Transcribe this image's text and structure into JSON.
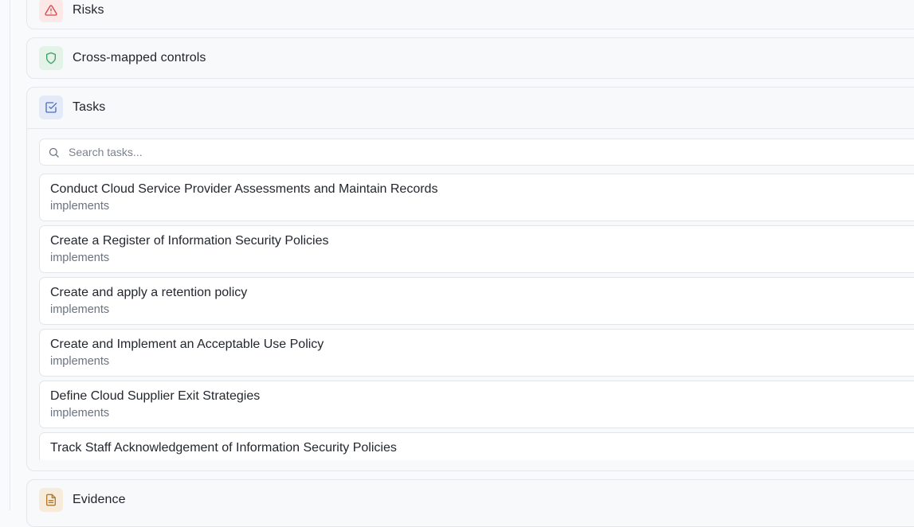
{
  "sections": {
    "risks": {
      "title": "Risks",
      "icon": "alert-triangle-icon",
      "color": "#d64545"
    },
    "cross_mapped": {
      "title": "Cross-mapped controls",
      "icon": "shield-icon",
      "color": "#3f9d63"
    },
    "tasks": {
      "title": "Tasks",
      "icon": "checkbox-icon",
      "color": "#4a6fb5",
      "search_placeholder": "Search tasks...",
      "items": [
        {
          "title": "Conduct Cloud Service Provider Assessments and Maintain Records",
          "relation": "implements"
        },
        {
          "title": "Create a Register of Information Security Policies",
          "relation": "implements"
        },
        {
          "title": "Create and apply a retention policy",
          "relation": "implements"
        },
        {
          "title": "Create and Implement an Acceptable Use Policy",
          "relation": "implements"
        },
        {
          "title": "Define Cloud Supplier Exit Strategies",
          "relation": "implements"
        },
        {
          "title": "Track Staff Acknowledgement of Information Security Policies",
          "relation": ""
        }
      ]
    },
    "evidence": {
      "title": "Evidence",
      "icon": "document-icon",
      "color": "#b07a2e"
    }
  }
}
